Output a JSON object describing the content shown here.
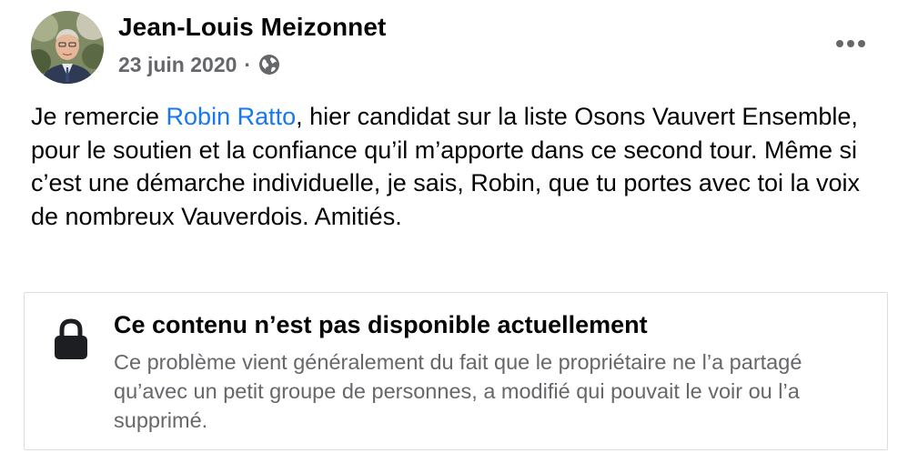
{
  "post": {
    "author_name": "Jean-Louis Meizonnet",
    "date": "23 juin 2020",
    "separator": "·",
    "privacy_icon": "globe-icon",
    "more_icon": "more-horizontal-icon",
    "text": {
      "before_mention": "Je remercie ",
      "mention": "Robin Ratto",
      "after_mention": ", hier candidat sur la liste Osons Vauvert Ensemble, pour le soutien et la confiance qu’il m’apporte dans ce second tour. Même si c’est une démarche individuelle, je sais, Robin, que tu portes avec toi la voix de nombreux Vauverdois. Amitiés."
    }
  },
  "unavailable_card": {
    "icon": "lock-icon",
    "title": "Ce contenu n’est pas disponible actuellement",
    "description": "Ce problème vient généralement du fait que le propriétaire ne l’a partagé qu’avec un petit groupe de personnes, a modifié qui pouvait le voir ou l’a supprimé."
  },
  "colors": {
    "text_primary": "#050505",
    "text_secondary": "#65676b",
    "link": "#1877f2",
    "card_border": "#dadde1"
  }
}
